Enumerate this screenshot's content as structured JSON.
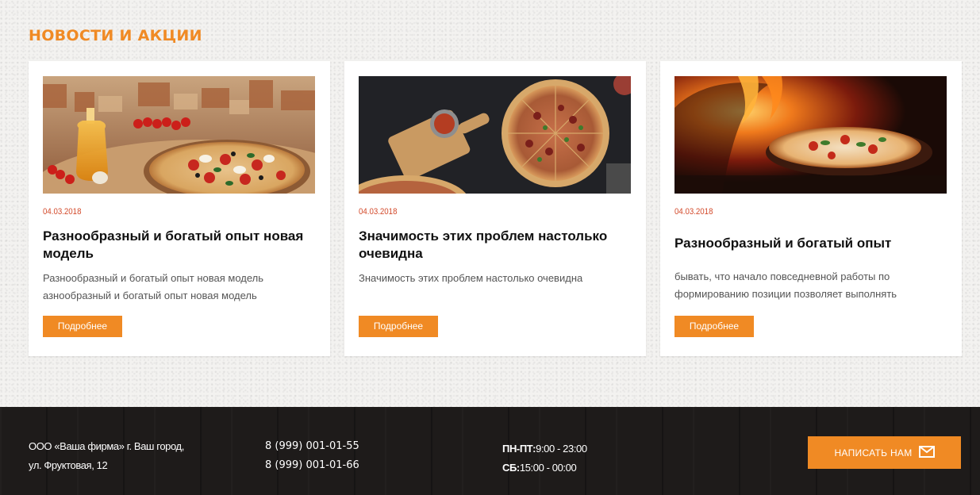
{
  "news": {
    "title": "НОВОСТИ И АКЦИИ",
    "cards": [
      {
        "date": "04.03.2018",
        "title": "Разнообразный и богатый опыт новая модель",
        "text": "Разнообразный и богатый опыт новая модель азнообразный и богатый опыт новая модель",
        "button": "Подробнее",
        "image": "pizza-olive-oil-city-view"
      },
      {
        "date": "04.03.2018",
        "title": "Значимость этих проблем настолько очевидна",
        "text": "Значимость этих проблем настолько очевидна",
        "button": "Подробнее",
        "image": "pizzas-on-dark-table"
      },
      {
        "date": "04.03.2018",
        "title": "Разнообразный и богатый опыт",
        "text": "бывать, что начало повседневной работы по формированию позиции позволяет выполнять",
        "button": "Подробнее",
        "image": "pizza-in-wood-oven"
      }
    ]
  },
  "footer": {
    "address_line1": "ООО «Ваша фирма» г. Ваш город,",
    "address_line2": "ул. Фруктовая, 12",
    "phone1": "8 (999) 001-01-55",
    "phone2": "8 (999) 001-01-66",
    "hours_weekdays_label": "ПН-ПТ:",
    "hours_weekdays": "9:00 - 23:00",
    "hours_sat_label": "СБ:",
    "hours_sat": "15:00 - 00:00",
    "contact_button": "НАПИСАТЬ НАМ",
    "contact_icon": "envelope-icon"
  },
  "colors": {
    "accent": "#f08a24",
    "date": "#d34a2b",
    "footer_bg": "#1e1b1a"
  }
}
